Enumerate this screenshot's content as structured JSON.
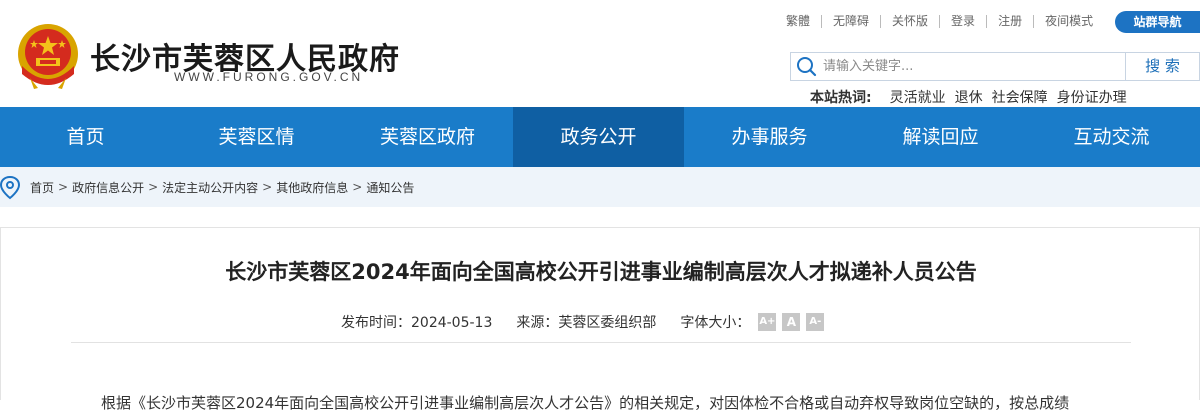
{
  "header": {
    "site_title": "长沙市芙蓉区人民政府",
    "site_domain": "WWW.FURONG.GOV.CN",
    "top_links": [
      "繁體",
      "无障碍",
      "关怀版",
      "登录",
      "注册",
      "夜间模式"
    ],
    "sitenav_label": "站群导航",
    "search": {
      "placeholder": "请输入关键字...",
      "button": "搜 索"
    },
    "hotwords": {
      "label": "本站热词:",
      "items": [
        "灵活就业",
        "退休",
        "社会保障",
        "身份证办理"
      ]
    }
  },
  "nav": {
    "items": [
      "首页",
      "芙蓉区情",
      "芙蓉区政府",
      "政务公开",
      "办事服务",
      "解读回应",
      "互动交流"
    ],
    "active_index": 3
  },
  "breadcrumb": [
    "首页",
    "政府信息公开",
    "法定主动公开内容",
    "其他政府信息",
    "通知公告"
  ],
  "breadcrumb_sep": ">",
  "article": {
    "title": "长沙市芙蓉区2024年面向全国高校公开引进事业编制高层次人才拟递补人员公告",
    "publish_time": "发布时间：2024-05-13",
    "source": "来源：芙蓉区委组织部",
    "font_size_label": "字体大小：",
    "font_buttons": [
      "A+",
      "A",
      "A-"
    ],
    "body_first_line": "根据《长沙市芙蓉区2024年面向全国高校公开引进事业编制高层次人才公告》的相关规定，对因体检不合格或自动弃权导致岗位空缺的，按总成绩"
  },
  "colors": {
    "nav": "#1a7cc9",
    "nav_active": "#0f5fa3",
    "accent": "#1d73c3",
    "crumb_bg": "#eef4fa"
  }
}
